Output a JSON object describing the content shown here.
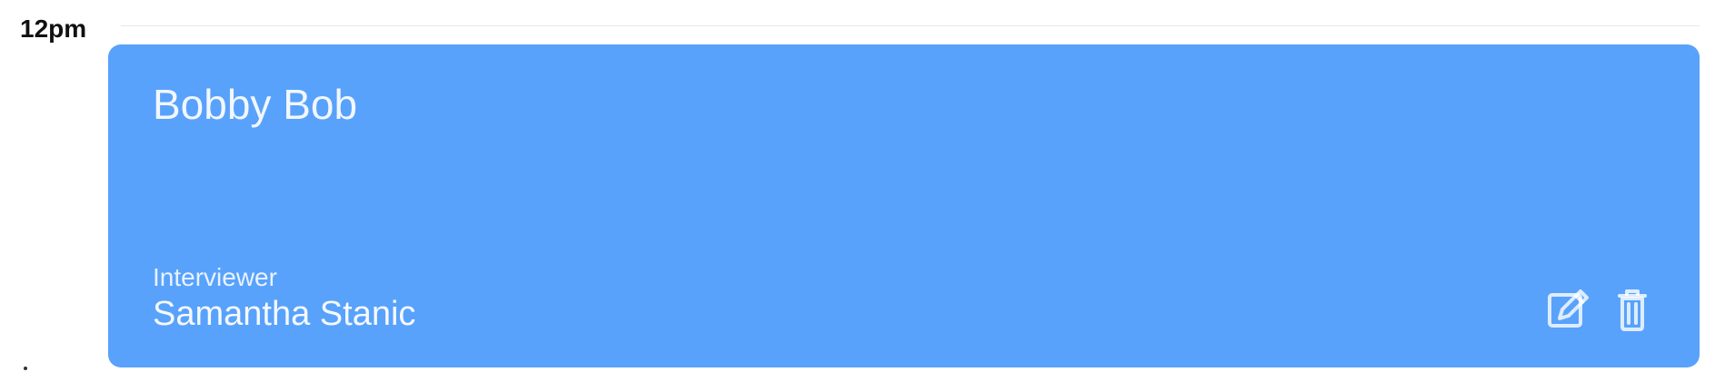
{
  "timeline": {
    "time_label": "12pm"
  },
  "event": {
    "title": "Bobby Bob",
    "interviewer_label": "Interviewer",
    "interviewer_name": "Samantha Stanic",
    "card_color": "#58a2fb",
    "text_color": "#f2f7ff"
  },
  "actions": {
    "edit_icon": "edit-icon",
    "delete_icon": "trash-icon"
  }
}
